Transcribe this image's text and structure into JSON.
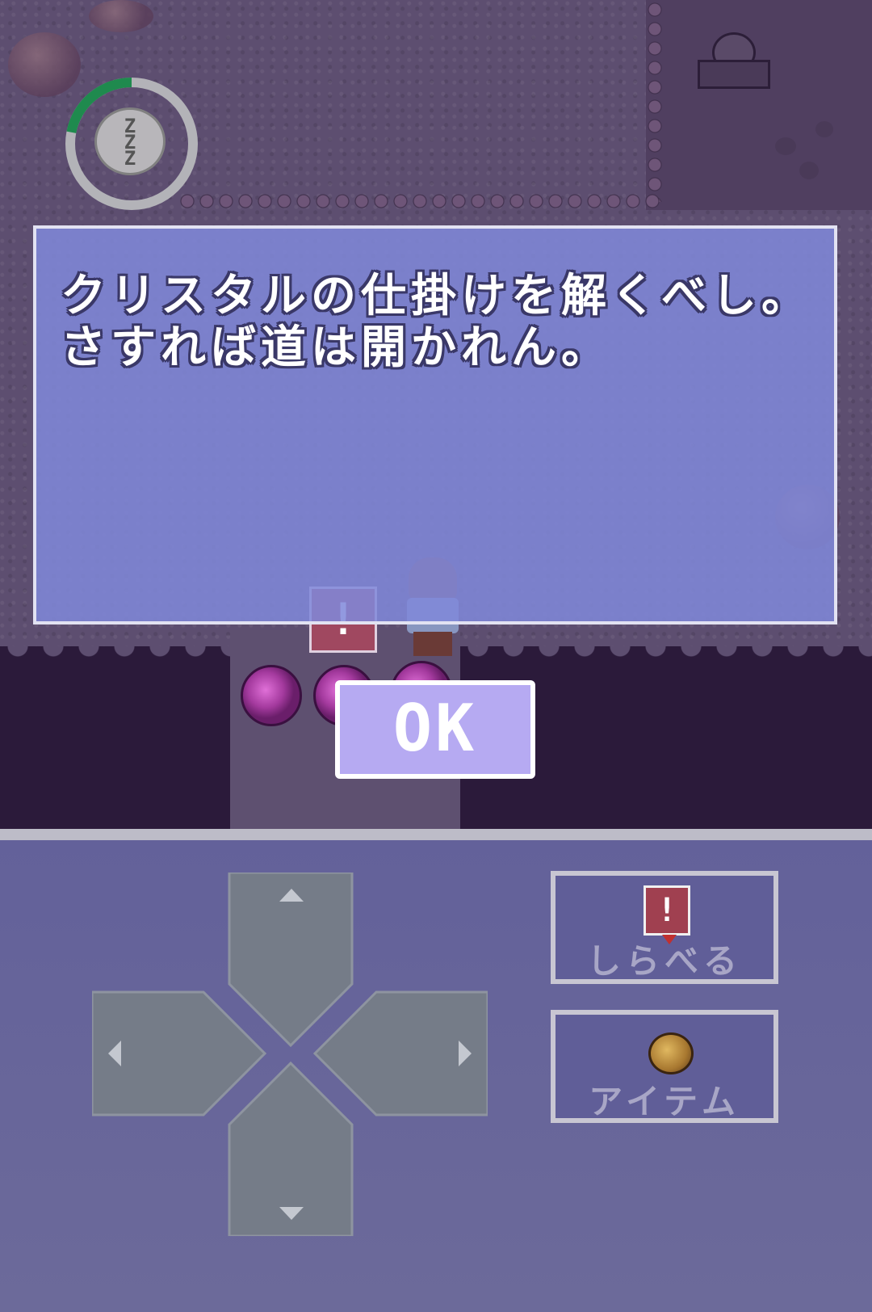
{
  "dialog": {
    "lines": [
      "クリスタルの仕掛けを解くべし。",
      "さすれば道は開かれん。"
    ],
    "ok_label": "OK"
  },
  "sleep_meter": {
    "icon": "sleep-zzz-icon",
    "glyph": "Z\nZ\nZ",
    "level": 0.22,
    "fill_color": "#1f8a4e",
    "track_color": "#b3b3b8"
  },
  "scene": {
    "alert_sign": "!"
  },
  "controls": {
    "dpad": {
      "up": "dpad-up",
      "down": "dpad-down",
      "left": "dpad-left",
      "right": "dpad-right"
    },
    "investigate": {
      "label": "しらべる",
      "icon": "exclamation-sign-icon",
      "icon_glyph": "!"
    },
    "item": {
      "label": "アイテム",
      "icon": "item-bag-icon"
    }
  },
  "colors": {
    "panel": "#63619a",
    "dpad": "#757c88",
    "dialog": "#8088da",
    "ok_button": "#b6aaf2"
  }
}
